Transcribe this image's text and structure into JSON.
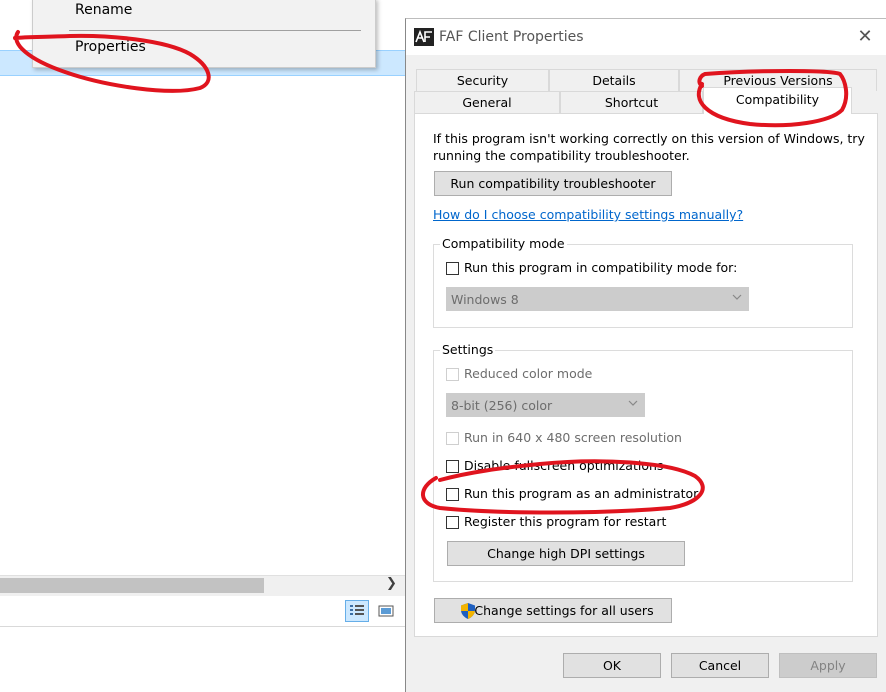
{
  "context_menu": {
    "items": [
      {
        "label": "Rename"
      },
      {
        "label": "Properties"
      }
    ]
  },
  "dialog": {
    "title": "FAF Client Properties",
    "tabs": [
      {
        "label": "Security"
      },
      {
        "label": "Details"
      },
      {
        "label": "Previous Versions"
      },
      {
        "label": "General"
      },
      {
        "label": "Shortcut"
      },
      {
        "label": "Compatibility"
      }
    ],
    "intro_line1": "If this program isn't working correctly on this version of Windows, try",
    "intro_line2": "running the compatibility troubleshooter.",
    "troubleshoot_button": "Run compatibility troubleshooter",
    "manual_link": "How do I choose compatibility settings manually?",
    "compat_mode": {
      "label": "Compatibility mode",
      "checkbox_label": "Run this program in compatibility mode for:",
      "checked": false,
      "combo_value": "Windows 8"
    },
    "settings": {
      "label": "Settings",
      "reduced_color": "Reduced color mode",
      "color_combo_value": "8-bit (256) color",
      "run_640": "Run in 640 x 480 screen resolution",
      "disable_fullscreen": "Disable fullscreen optimizations",
      "run_as_admin": "Run this program as an administrator",
      "register_restart": "Register this program for restart",
      "dpi_button": "Change high DPI settings"
    },
    "all_users_button": "Change settings for all users",
    "ok_button": "OK",
    "cancel_button": "Cancel",
    "apply_button": "Apply"
  },
  "colors": {
    "annotation": "#e0141e",
    "link": "#0066cc",
    "selection": "#cce8ff"
  }
}
